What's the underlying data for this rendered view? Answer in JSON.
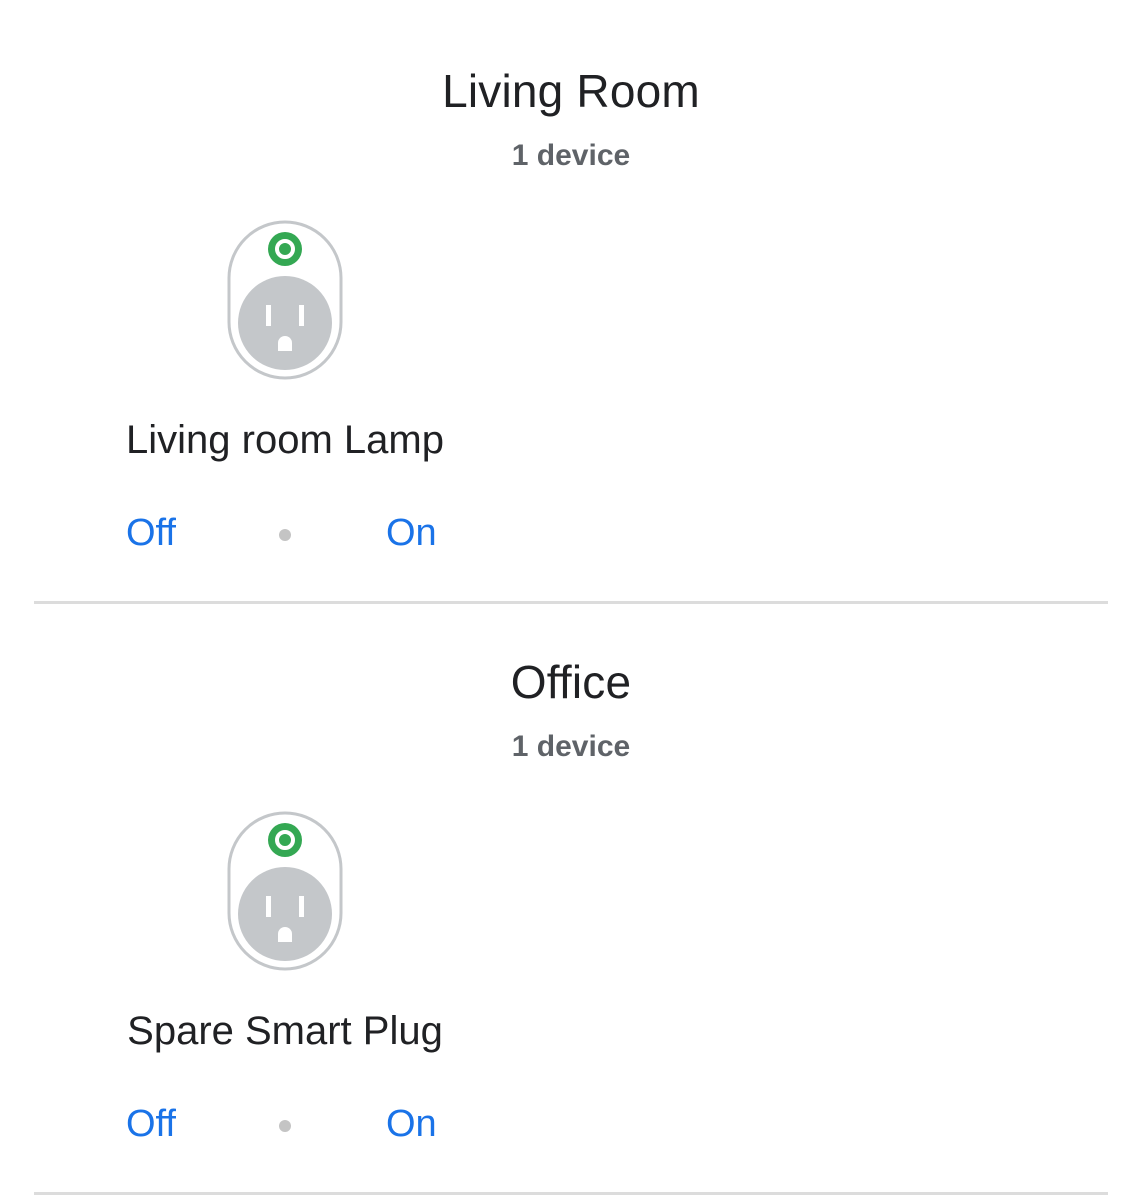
{
  "rooms": [
    {
      "title": "Living Room",
      "subtitle": "1 device",
      "device": {
        "name": "Living room Lamp",
        "icon": "smart-plug-icon",
        "off_label": "Off",
        "on_label": "On"
      }
    },
    {
      "title": "Office",
      "subtitle": "1 device",
      "device": {
        "name": "Spare Smart Plug",
        "icon": "smart-plug-icon",
        "off_label": "Off",
        "on_label": "On"
      }
    }
  ],
  "colors": {
    "accent": "#1a73e8",
    "status_on": "#34a853",
    "plug_gray": "#c4c7ca",
    "divider": "#dcdcdc"
  }
}
